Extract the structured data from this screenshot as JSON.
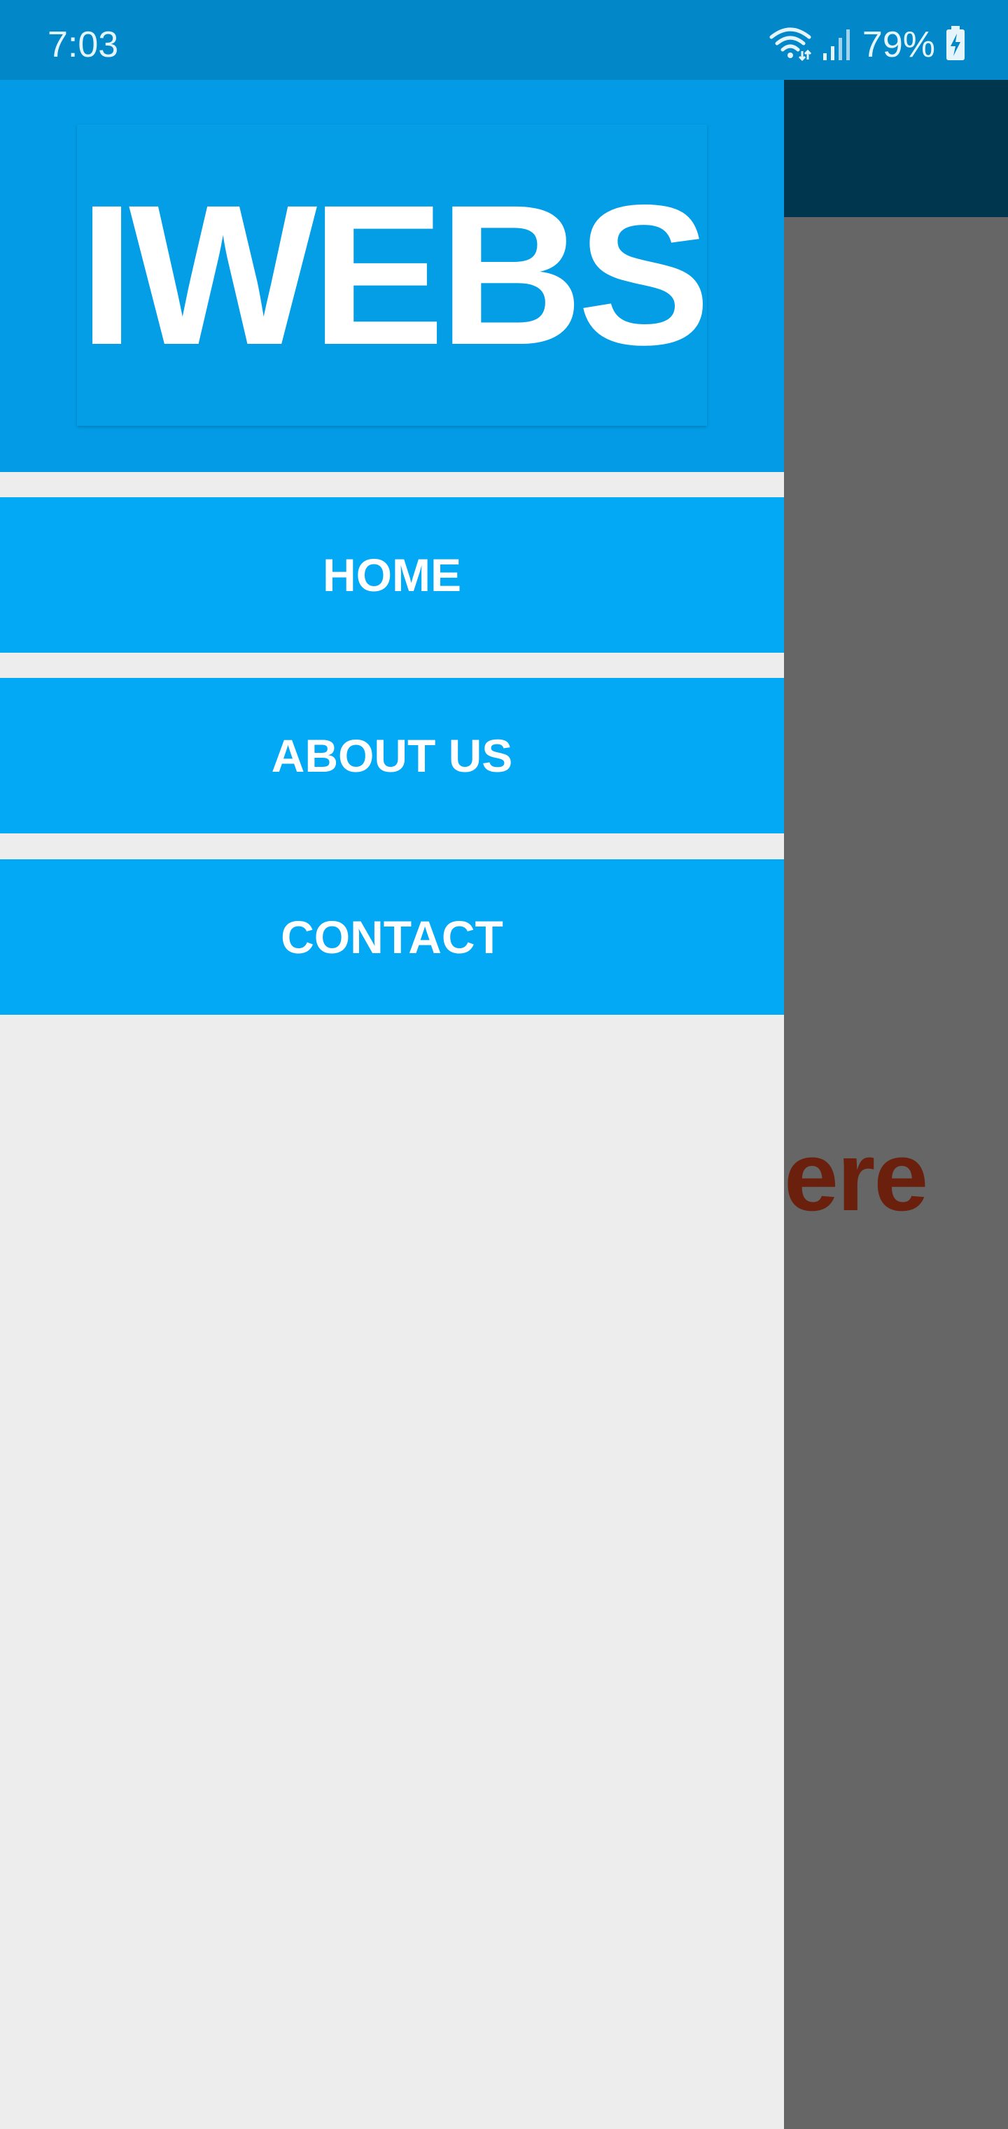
{
  "status_bar": {
    "time": "7:03",
    "battery": "79%",
    "icons": [
      "wifi-icon",
      "signal-icon",
      "battery-charging-icon"
    ]
  },
  "drawer": {
    "logo": "IWEBS",
    "menu": [
      {
        "label": "HOME"
      },
      {
        "label": "ABOUT US"
      },
      {
        "label": "CONTACT"
      }
    ]
  },
  "background_page": {
    "visible_text": "ere"
  },
  "colors": {
    "status_bar": "#0288c8",
    "drawer_header": "#039be5",
    "menu_item": "#03a9f4",
    "drawer_bg": "#ededed",
    "toolbar": "#00374f",
    "scrim_content": "#666666",
    "content_text": "#6a200d"
  }
}
